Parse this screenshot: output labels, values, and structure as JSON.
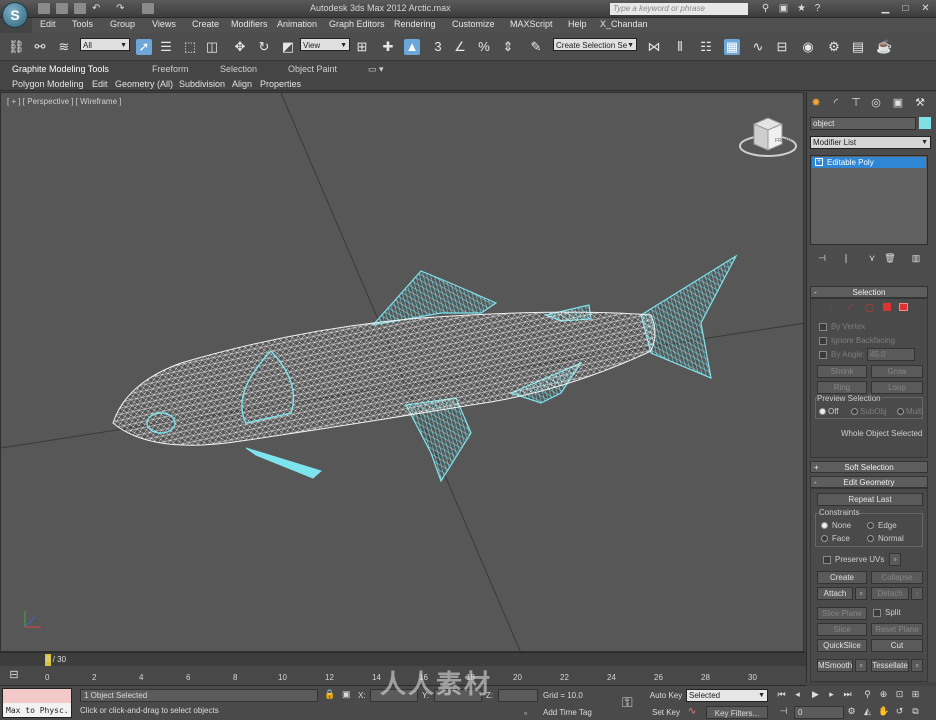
{
  "titlebar": {
    "title": "Autodesk 3ds Max 2012     Arctic.max",
    "search_placeholder": "Type a keyword or phrase",
    "app_logo_letter": "S"
  },
  "menu": [
    "Edit",
    "Tools",
    "Group",
    "Views",
    "Create",
    "Modifiers",
    "Animation",
    "Graph Editors",
    "Rendering",
    "Customize",
    "MAXScript",
    "Help",
    "X_Chandan"
  ],
  "toolbar": {
    "selection_filter": "All",
    "ref_coord": "View",
    "named_selection": "Create Selection Se"
  },
  "ribbon": {
    "tabs": [
      "Graphite Modeling Tools",
      "Freeform",
      "Selection",
      "Object Paint"
    ],
    "subtabs": [
      "Polygon Modeling",
      "Edit",
      "Geometry (All)",
      "Subdivision",
      "Align",
      "Properties"
    ]
  },
  "viewport": {
    "label": "[ + ] [ Perspective ] [ Wireframe ]",
    "viewcube_label": "FRONT"
  },
  "command_panel": {
    "object_name": "object",
    "object_color": "#7fe0e6",
    "modifier_list": "Modifier List",
    "stack_item": "Editable Poly",
    "selection": {
      "title": "Selection",
      "by_vertex": "By Vertex",
      "ignore_backfacing": "Ignore Backfacing",
      "by_angle": "By Angle:",
      "angle_value": "45.0",
      "shrink": "Shrink",
      "grow": "Grow",
      "ring": "Ring",
      "loop": "Loop",
      "preview_title": "Preview Selection",
      "preview_off": "Off",
      "preview_subobj": "SubObj",
      "preview_multi": "Multi",
      "status": "Whole Object Selected"
    },
    "soft_selection": "Soft Selection",
    "edit_geometry": {
      "title": "Edit Geometry",
      "repeat_last": "Repeat Last",
      "constraints": "Constraints",
      "none": "None",
      "edge": "Edge",
      "face": "Face",
      "normal": "Normal",
      "preserve_uvs": "Preserve UVs",
      "create": "Create",
      "collapse": "Collapse",
      "attach": "Attach",
      "detach": "Detach",
      "slice_plane": "Slice Plane",
      "split": "Split",
      "slice": "Slice",
      "reset_plane": "Reset Plane",
      "quickslice": "QuickSlice",
      "cut": "Cut",
      "msmooth": "MSmooth",
      "tessellate": "Tessellate"
    }
  },
  "timeline": {
    "frame_label": "0 / 30",
    "ticks": [
      "0",
      "2",
      "4",
      "6",
      "8",
      "10",
      "12",
      "14",
      "16",
      "18",
      "20",
      "22",
      "24",
      "26",
      "28",
      "30"
    ]
  },
  "status": {
    "maxscript": "Max to Physc.",
    "selected": "1 Object Selected",
    "prompt": "Click or click-and-drag to select objects",
    "x_label": "X:",
    "y_label": "Y:",
    "z_label": "Z:",
    "grid": "Grid = 10.0",
    "add_time_tag": "Add Time Tag",
    "auto_key": "Auto Key",
    "set_key": "Set Key",
    "key_mode": "Selected",
    "key_filters": "Key Filters...",
    "current_frame": "0"
  },
  "watermark": "人人素材"
}
